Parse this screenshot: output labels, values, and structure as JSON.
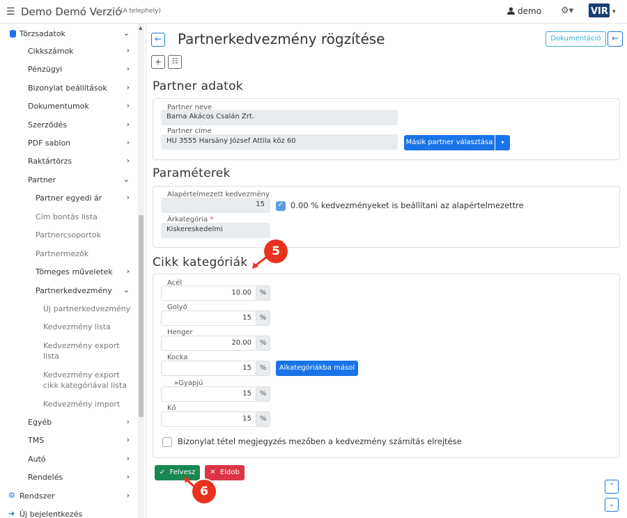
{
  "topbar": {
    "app_title": "Demo Demó Verzió",
    "app_sub": "(A telephely)",
    "user": "demo",
    "logo_text": "VIR"
  },
  "sidebar": {
    "items": [
      {
        "label": "Törzsadatok",
        "icon": "database-icon"
      },
      {
        "label": "Cikkszámok"
      },
      {
        "label": "Pénzügyi"
      },
      {
        "label": "Bizonylat beállítások"
      },
      {
        "label": "Dokumentumok"
      },
      {
        "label": "Szerződés"
      },
      {
        "label": "PDF sablon"
      },
      {
        "label": "Raktártörzs"
      },
      {
        "label": "Partner"
      },
      {
        "label": "Partner egyedi ár"
      },
      {
        "label": "Cím bontás lista"
      },
      {
        "label": "Partnercsoportok"
      },
      {
        "label": "Partnermezők"
      },
      {
        "label": "Tömeges műveletek"
      },
      {
        "label": "Partnerkedvezmény"
      },
      {
        "label": "Új partnerkedvezmény"
      },
      {
        "label": "Kedvezmény lista"
      },
      {
        "label": "Kedvezmény export"
      },
      {
        "label": "lista"
      },
      {
        "label": "Kedvezmény export"
      },
      {
        "label": "cikk kategóriával lista"
      },
      {
        "label": "Kedvezmény import"
      },
      {
        "label": "Egyéb"
      },
      {
        "label": "TMS"
      },
      {
        "label": "Autó"
      },
      {
        "label": "Rendelés"
      },
      {
        "label": "Rendszer",
        "icon": "cogs-icon"
      },
      {
        "label": "Új bejelentkezés",
        "icon": "login-icon"
      }
    ]
  },
  "page": {
    "title": "Partnerkedvezmény rögzítése",
    "doc_button": "Dokumentáció"
  },
  "partner": {
    "section_title": "Partner adatok",
    "name_label": "Partner neve",
    "name_value": "Barna Akácos Csalán Zrt.",
    "address_label": "Partner címe",
    "address_value": "HU 3555 Harsány József Attila köz 60",
    "other_partner_button": "Másik partner választása"
  },
  "params": {
    "section_title": "Paraméterek",
    "default_discount_label": "Alapértelmezett kedvezmény",
    "default_discount_value": "15",
    "zero_checkbox_label": "0.00 % kedvezményeket is beállítani az alapértelmezettre",
    "price_category_label": "Árkategória",
    "price_category_required": "*",
    "price_category_value": "Kiskereskedelmi"
  },
  "categories": {
    "section_title": "Cikk kategóriák",
    "unit": "%",
    "items": [
      {
        "label": "Acél",
        "value": "10.00"
      },
      {
        "label": "Golyó",
        "value": "15"
      },
      {
        "label": "Henger",
        "value": "20.00"
      },
      {
        "label": "Kocka",
        "value": "15"
      },
      {
        "label": "»Gyapjú",
        "value": "15"
      },
      {
        "label": "Kő",
        "value": "15"
      }
    ],
    "copy_button": "Alkategóriákba másol",
    "hide_checkbox_label": "Bizonylat tétel megjegyzés mezőben a kedvezmény számítás elrejtése"
  },
  "actions": {
    "save": "Felvesz",
    "discard": "Eldob"
  },
  "annotations": {
    "badge_5": "5",
    "badge_6": "6"
  }
}
